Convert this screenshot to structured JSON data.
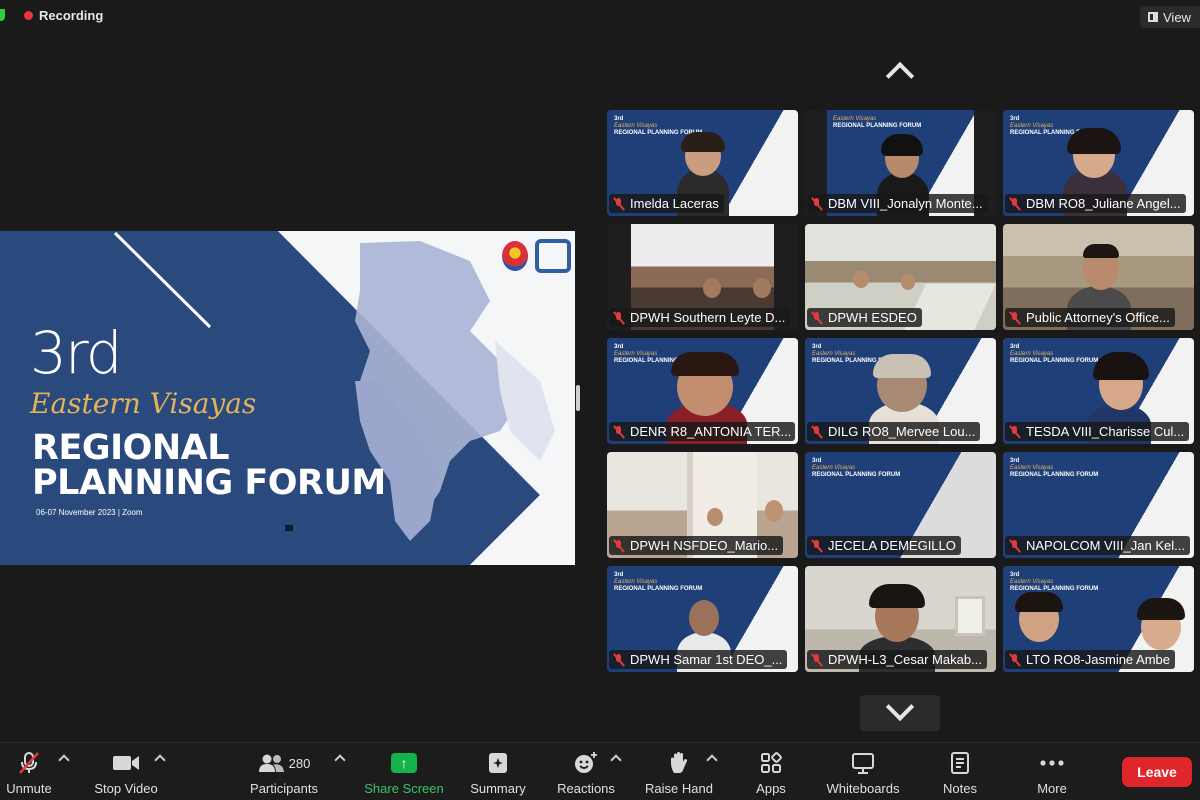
{
  "top_bar": {
    "recording_label": "Recording",
    "view_label": "View"
  },
  "shared_screen": {
    "title_number": "3rd",
    "title_region": "Eastern Visayas",
    "title_line1": "REGIONAL",
    "title_line2": "PLANNING FORUM",
    "date_line": "06-07 November 2023 | Zoom"
  },
  "gallery": {
    "participants": [
      {
        "name": "Imelda Laceras"
      },
      {
        "name": "DBM VIII_Jonalyn Monte..."
      },
      {
        "name": "DBM RO8_Juliane Angel..."
      },
      {
        "name": "DPWH Southern Leyte D..."
      },
      {
        "name": "DPWH ESDEO"
      },
      {
        "name": "Public Attorney's Office..."
      },
      {
        "name": "DENR R8_ANTONIA TER..."
      },
      {
        "name": "DILG RO8_Mervee Lou..."
      },
      {
        "name": "TESDA VIII_Charisse Cul..."
      },
      {
        "name": "DPWH NSFDEO_Mario..."
      },
      {
        "name": "JECELA DEMEGILLO"
      },
      {
        "name": "NAPOLCOM VIII_Jan Kel..."
      },
      {
        "name": "DPWH Samar 1st DEO_..."
      },
      {
        "name": "DPWH-L3_Cesar Makab..."
      },
      {
        "name": "LTO RO8-Jasmine Ambe"
      }
    ]
  },
  "toolbar": {
    "unmute": "Unmute",
    "stop_video": "Stop Video",
    "participants": "Participants",
    "participant_count": "280",
    "share_screen": "Share Screen",
    "summary": "Summary",
    "reactions": "Reactions",
    "raise_hand": "Raise Hand",
    "apps": "Apps",
    "whiteboards": "Whiteboards",
    "notes": "Notes",
    "more": "More",
    "leave": "Leave"
  },
  "colors": {
    "slide_navy": "#2a4a7e",
    "accent_gold": "#e3b25c",
    "share_green": "#13b24b",
    "leave_red": "#e0262b",
    "muted_red": "#e23b3b"
  }
}
